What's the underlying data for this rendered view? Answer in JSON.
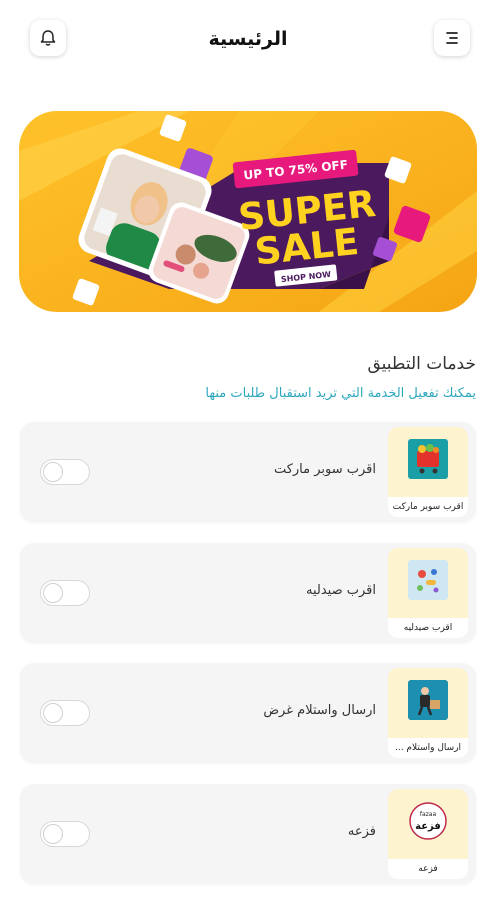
{
  "header": {
    "title": "الرئيسية",
    "bell_icon": "bell-icon",
    "menu_icon": "menu-icon"
  },
  "banner": {
    "badge": "UP TO 75% OFF",
    "line1": "SUPER",
    "line2": "SALE",
    "cta": "SHOP NOW",
    "colors": {
      "background": "#f8b11d",
      "purple": "#4b1a5e",
      "pink": "#e8197d",
      "yellow": "#ffd21f"
    }
  },
  "services": {
    "title": "خدمات التطبيق",
    "subtitle": "يمكنك تفعيل الخدمة التي تريد استقبال طلبات منها",
    "items": [
      {
        "label": "اقرب سوبر ماركت",
        "thumb_caption": "اقرب سوبر ماركت",
        "enabled": false
      },
      {
        "label": "اقرب صيدليه",
        "thumb_caption": "اقرب صيدليه",
        "enabled": false
      },
      {
        "label": "ارسال واستلام غرض",
        "thumb_caption": "ارسال واستلام ...",
        "enabled": false
      },
      {
        "label": "فزعه",
        "thumb_caption": "فزعه",
        "logo_latin": "fazaa",
        "logo_arabic": "فزعة",
        "enabled": false
      }
    ]
  }
}
